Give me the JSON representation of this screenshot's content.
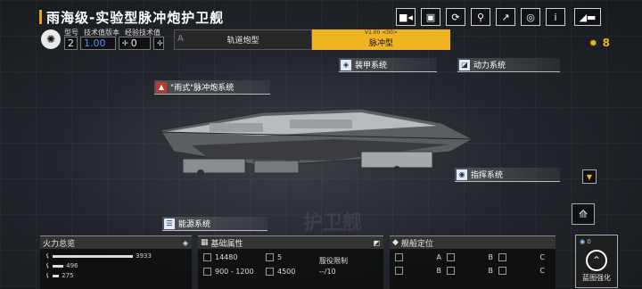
{
  "header": {
    "title": "雨海级-实验型脉冲炮护卫舰"
  },
  "toolbar": {
    "icons": [
      "video-icon",
      "image-icon",
      "refresh-icon",
      "pin-icon",
      "export-icon",
      "focus-icon",
      "info-icon",
      "return-icon"
    ],
    "info_label": "i"
  },
  "meta": {
    "labels": [
      "型号",
      "技术值版本",
      "经验技术值"
    ],
    "model": "2",
    "tech": "1.00",
    "exp": "0"
  },
  "tabs": {
    "a_mark": "A",
    "a_label": "轨道炮型",
    "b_version": "V1.00 <00>",
    "b_label": "脉冲型"
  },
  "resources": {
    "count": "8"
  },
  "systems": {
    "weapon": "\"雨式\"脉冲炮系统",
    "armor": "装甲系统",
    "power": "动力系统",
    "command": "指挥系统",
    "energy": "能源系统"
  },
  "watermark": "护卫舰",
  "firepower": {
    "title": "火力总览",
    "rows": [
      {
        "value": "3933",
        "fill": 0.9
      },
      {
        "value": "496",
        "fill": 0.12
      },
      {
        "value": "275",
        "fill": 0.07
      }
    ]
  },
  "basic": {
    "title": "基础属性",
    "hp": "14480",
    "armor": "5",
    "dash": "--",
    "range": "900 - 1200",
    "speed": "4500",
    "service_label": "服役限制",
    "service_value": "--/10"
  },
  "position": {
    "title": "舰船定位",
    "grades": [
      "A",
      "B",
      "C",
      "B",
      "B",
      "C"
    ]
  },
  "blueprint": {
    "label": "蓝图强化",
    "count": "0"
  },
  "colors": {
    "accent": "#f0b423"
  }
}
